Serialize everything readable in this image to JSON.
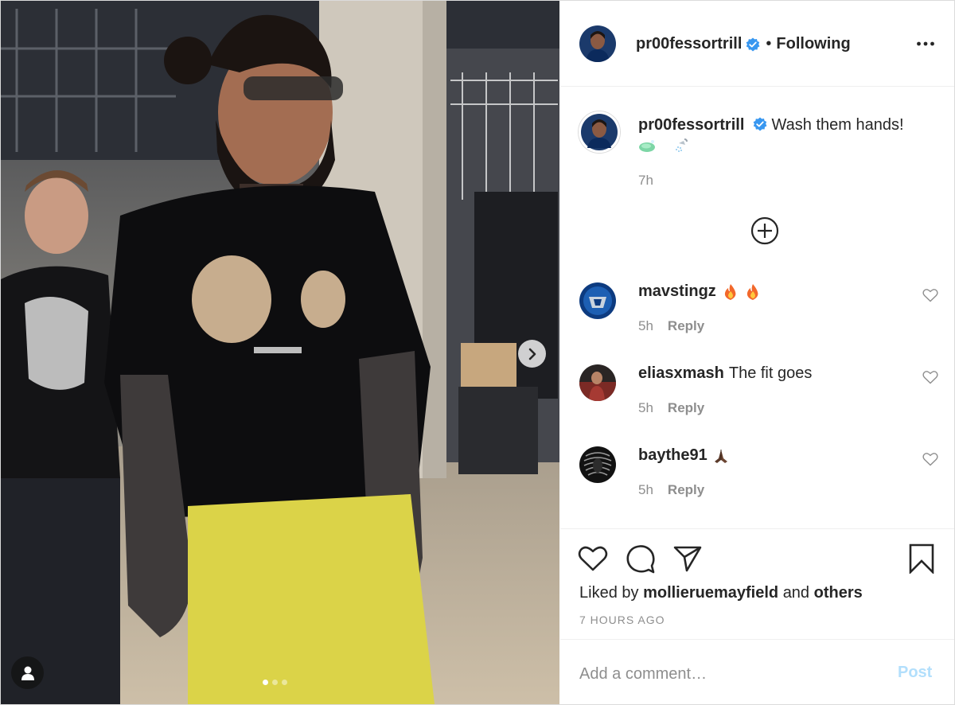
{
  "post": {
    "author": "pr00fessortrill",
    "separator": "•",
    "follow_status": "Following",
    "more_icon": "more-horizontal-icon",
    "caption_text": "Wash them hands!",
    "caption_emojis": [
      "soap-emoji",
      "shower-emoji"
    ],
    "caption_time": "7h",
    "media": {
      "slide_count": 3,
      "active_slide": 1
    }
  },
  "comments": [
    {
      "username": "mavstingz",
      "text": "",
      "emojis": [
        "fire-emoji",
        "fire-emoji"
      ],
      "time": "5h",
      "reply_label": "Reply"
    },
    {
      "username": "eliasxmash",
      "text": "The fit goes",
      "emojis": [],
      "time": "5h",
      "reply_label": "Reply"
    },
    {
      "username": "baythe91",
      "text": "",
      "emojis": [
        "folded-hands-emoji"
      ],
      "time": "5h",
      "reply_label": "Reply"
    }
  ],
  "actions": {
    "liked_by_prefix": "Liked by",
    "liked_by_user": "mollieruemayfield",
    "liked_by_and": "and",
    "liked_by_others": "others",
    "timestamp": "7 HOURS AGO"
  },
  "add_comment": {
    "placeholder": "Add a comment…",
    "post_label": "Post"
  },
  "colors": {
    "verified_blue": "#3897f0",
    "post_button_disabled": "#b2dffc",
    "secondary_text": "#8e8e8e"
  }
}
